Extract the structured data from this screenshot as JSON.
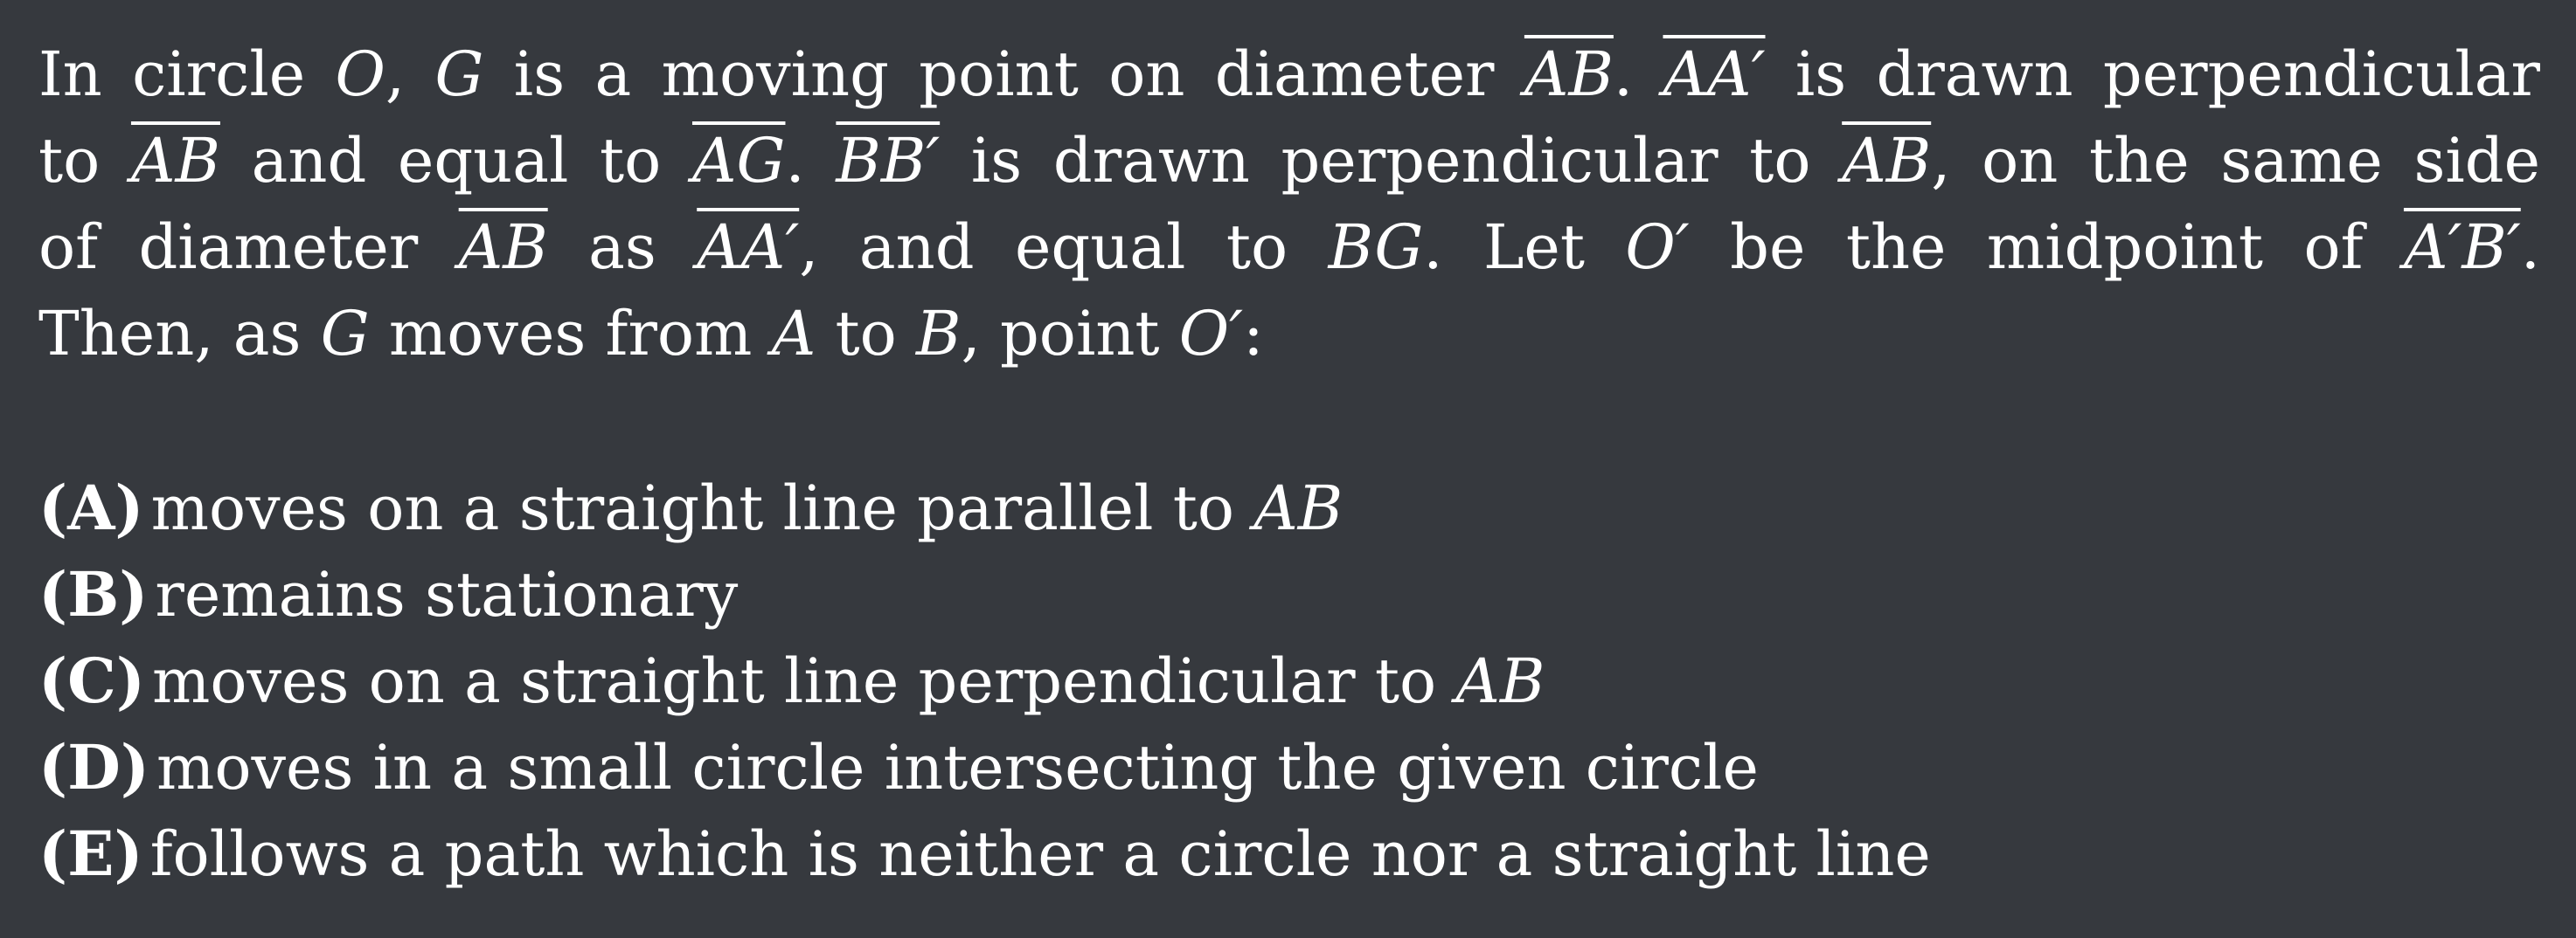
{
  "problem": {
    "stem": {
      "line1": {
        "t1": "In circle ",
        "m1": "O",
        "t2": ", ",
        "m2": "G",
        "t3": " is a moving point on diameter ",
        "m3": "AB",
        "t4": ". ",
        "m4": "AA′",
        "t5": " is drawn perpendicular"
      },
      "line2": {
        "t1": "to ",
        "m1": "AB",
        "t2": " and equal to ",
        "m2": "AG",
        "t3": ". ",
        "m3": "BB′",
        "t4": " is drawn perpendicular to ",
        "m4": "AB",
        "t5": ", on the same side"
      },
      "line3": {
        "t1": "of diameter ",
        "m1": "AB",
        "t2": " as ",
        "m2": "AA′",
        "t3": ", and equal to ",
        "m3": "BG",
        "t4": ".  Let ",
        "m4": "O′",
        "t5": " be the midpoint of ",
        "m5": "A′B′",
        "t6": "."
      },
      "line4": {
        "t1": "Then, as ",
        "m1": "G",
        "t2": " moves from ",
        "m2": "A",
        "t3": " to ",
        "m3": "B",
        "t4": ", point ",
        "m4": "O′",
        "t5": ":"
      }
    },
    "choices": [
      {
        "letter": "(A)",
        "text": "moves on a straight line parallel to ",
        "math": "AB"
      },
      {
        "letter": "(B)",
        "text": "remains stationary",
        "math": ""
      },
      {
        "letter": "(C)",
        "text": "moves on a straight line perpendicular to ",
        "math": "AB"
      },
      {
        "letter": "(D)",
        "text": "moves in a small circle intersecting the given circle",
        "math": ""
      },
      {
        "letter": "(E)",
        "text": "follows a path which is neither a circle nor a straight line",
        "math": ""
      }
    ]
  }
}
